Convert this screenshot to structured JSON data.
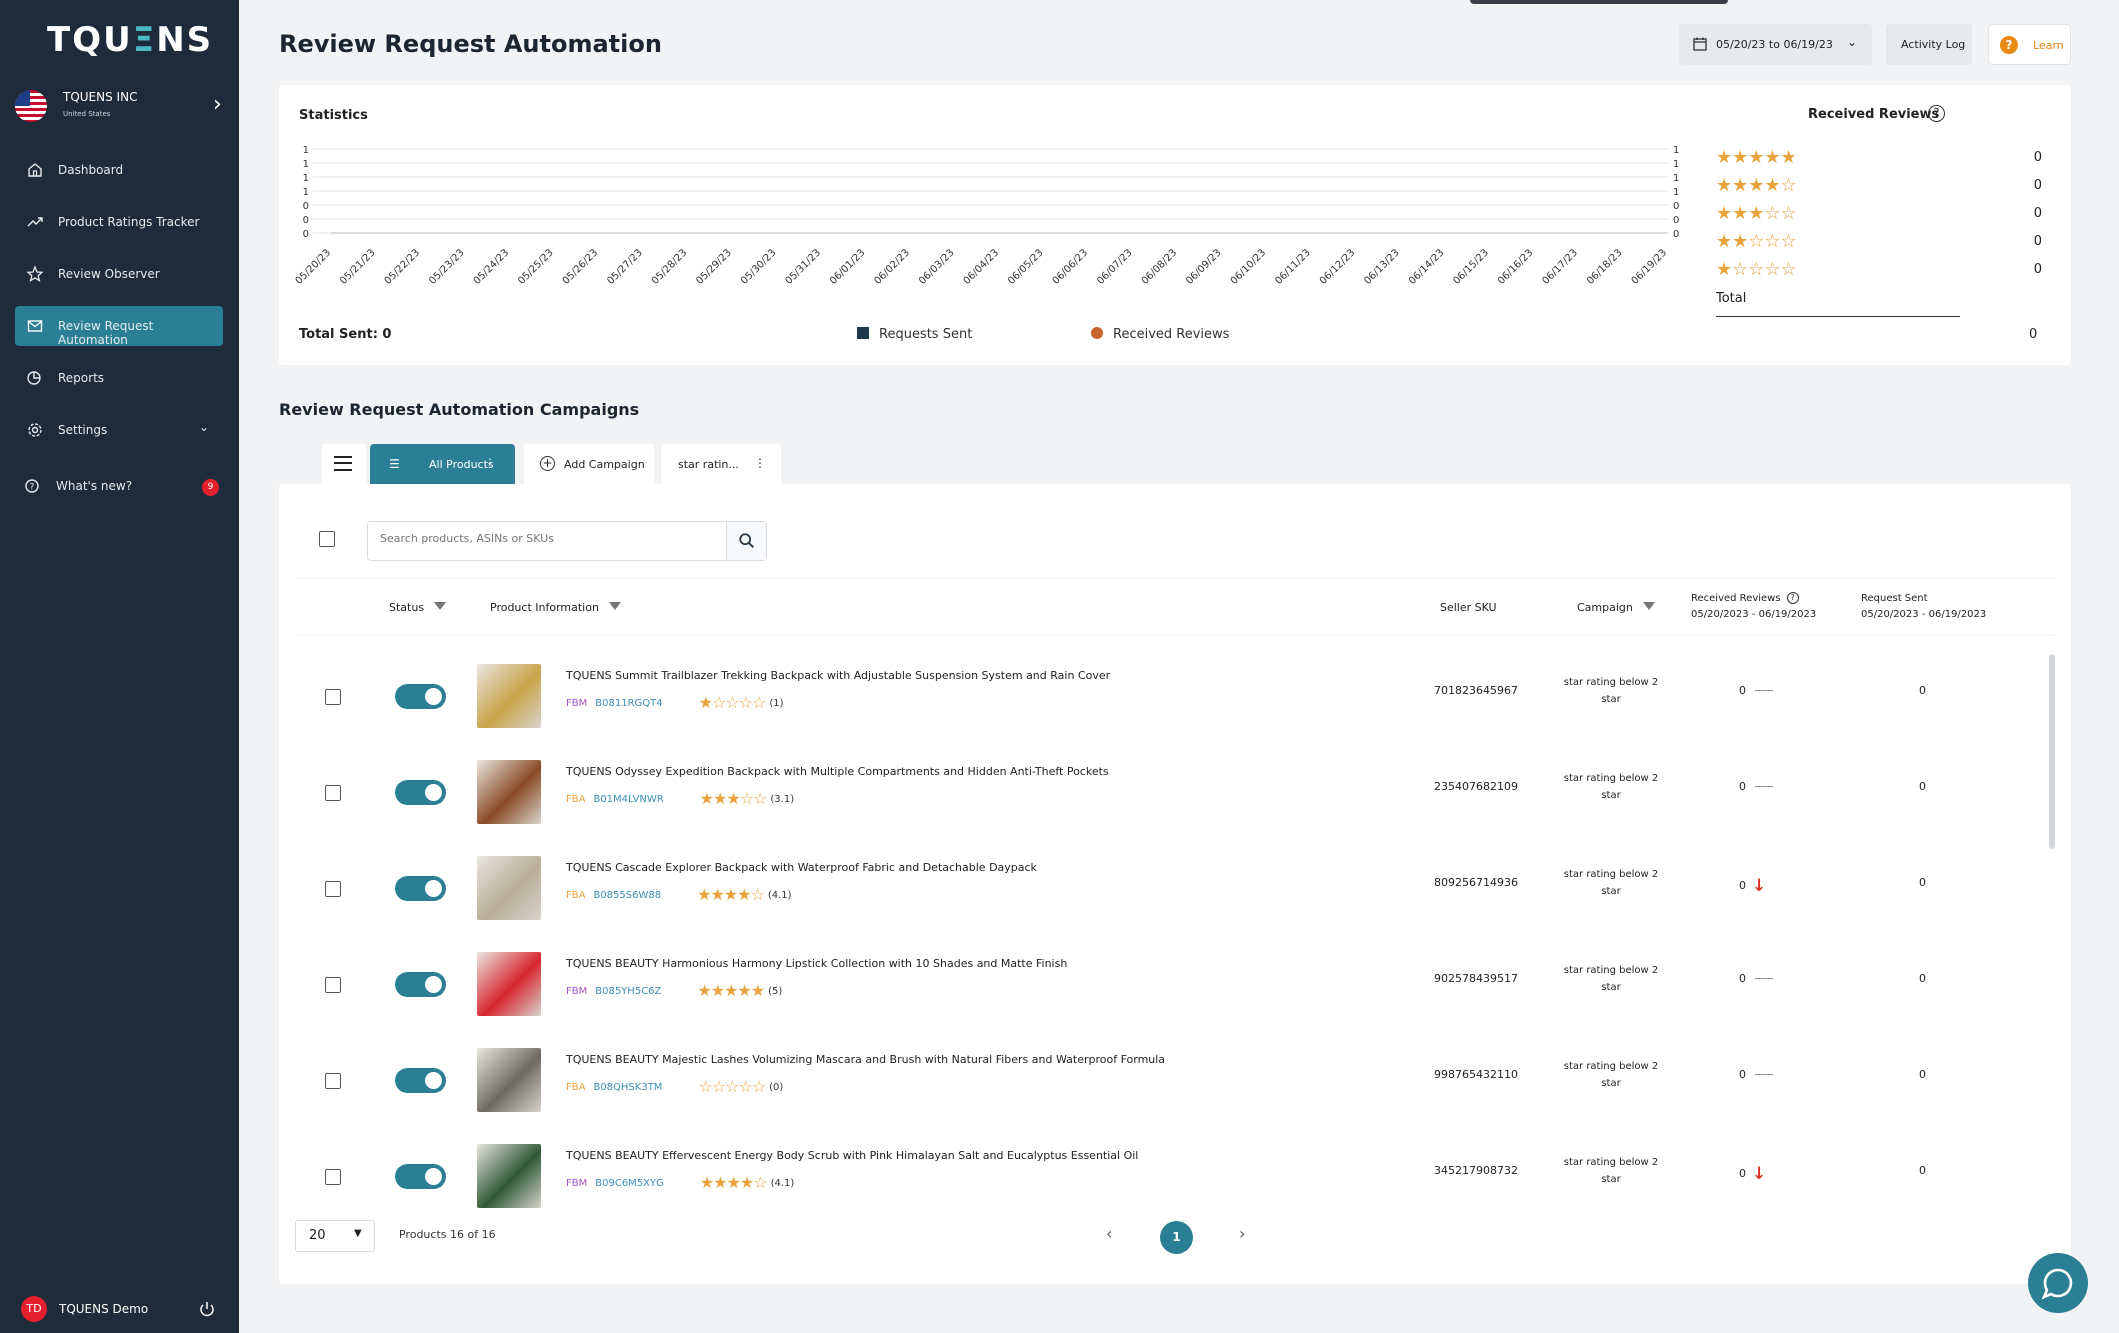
{
  "brand": {
    "logo_left": "TQU",
    "logo_accent": "Ξ",
    "logo_right": "NS"
  },
  "account": {
    "name": "TQUENS INC",
    "country": "United States"
  },
  "sidebar": {
    "items": [
      {
        "label": "Dashboard",
        "icon": "home-icon"
      },
      {
        "label": "Product Ratings Tracker",
        "icon": "trend-icon"
      },
      {
        "label": "Review Observer",
        "icon": "star-icon"
      },
      {
        "label": "Review Request Automation",
        "icon": "mail-icon",
        "active": true
      },
      {
        "label": "Reports",
        "icon": "report-icon"
      },
      {
        "label": "Settings",
        "icon": "gear-icon"
      },
      {
        "label": "What's new?",
        "icon": "help-icon",
        "badge": "9"
      }
    ]
  },
  "user": {
    "initials": "TD",
    "name": "TQUENS Demo"
  },
  "header": {
    "title": "Review Request Automation",
    "date_range": "05/20/23 to 06/19/23",
    "activity_log": "Activity Log",
    "learn": "Learn"
  },
  "stats": {
    "title": "Statistics",
    "total_sent": "Total Sent: 0",
    "legend": [
      {
        "name": "Requests Sent",
        "color": "#1e3a4c"
      },
      {
        "name": "Received Reviews",
        "color": "#c8652a"
      }
    ]
  },
  "chart_data": {
    "type": "line",
    "x": [
      "05/20/23",
      "05/21/23",
      "05/22/23",
      "05/23/23",
      "05/24/23",
      "05/25/23",
      "05/26/23",
      "05/27/23",
      "05/28/23",
      "05/29/23",
      "05/30/23",
      "05/31/23",
      "06/01/23",
      "06/02/23",
      "06/03/23",
      "06/04/23",
      "06/05/23",
      "06/06/23",
      "06/07/23",
      "06/08/23",
      "06/09/23",
      "06/10/23",
      "06/11/23",
      "06/12/23",
      "06/13/23",
      "06/14/23",
      "06/15/23",
      "06/16/23",
      "06/17/23",
      "06/18/23",
      "06/19/23"
    ],
    "y_ticks_left": [
      "1",
      "1",
      "1",
      "1",
      "0",
      "0",
      "0"
    ],
    "y_ticks_right": [
      "1",
      "1",
      "1",
      "1",
      "0",
      "0",
      "0"
    ],
    "series": [
      {
        "name": "Requests Sent",
        "values": [
          0,
          0,
          0,
          0,
          0,
          0,
          0,
          0,
          0,
          0,
          0,
          0,
          0,
          0,
          0,
          0,
          0,
          0,
          0,
          0,
          0,
          0,
          0,
          0,
          0,
          0,
          0,
          0,
          0,
          0,
          0
        ]
      },
      {
        "name": "Received Reviews",
        "values": [
          0,
          0,
          0,
          0,
          0,
          0,
          0,
          0,
          0,
          0,
          0,
          0,
          0,
          0,
          0,
          0,
          0,
          0,
          0,
          0,
          0,
          0,
          0,
          0,
          0,
          0,
          0,
          0,
          0,
          0,
          0
        ]
      }
    ],
    "grid": true
  },
  "received_reviews": {
    "title": "Received Reviews",
    "help": "?",
    "rows": [
      {
        "stars": "★★★★★",
        "count": "0"
      },
      {
        "stars": "★★★★☆",
        "count": "0"
      },
      {
        "stars": "★★★☆☆",
        "count": "0"
      },
      {
        "stars": "★★☆☆☆",
        "count": "0"
      },
      {
        "stars": "★☆☆☆☆",
        "count": "0"
      }
    ],
    "total_label": "Total",
    "total_value": "0"
  },
  "campaigns": {
    "title": "Review Request Automation Campaigns",
    "tabs": {
      "all": "All Products",
      "add": "Add Campaign",
      "star": "star ratin..."
    },
    "search_placeholder": "Search products, ASINs or SKUs",
    "columns": {
      "status": "Status",
      "product": "Product Information",
      "sku": "Seller SKU",
      "campaign": "Campaign",
      "received": "Received Reviews",
      "received_range": "05/20/2023 - 06/19/2023",
      "sent": "Request Sent",
      "sent_range": "05/20/2023 - 06/19/2023"
    },
    "rows": [
      {
        "name": "TQUENS Summit Trailblazer Trekking Backpack with Adjustable Suspension System and Rain Cover",
        "fulfillment": "FBM",
        "asin": "B0811RGQT4",
        "stars": "★☆☆☆☆",
        "rating": "(1)",
        "sku": "701823645967",
        "campaign": "star rating below 2 star",
        "received": "0",
        "trend": "flat",
        "sent": "0",
        "thumb_color": "#c9a44a"
      },
      {
        "name": "TQUENS Odyssey Expedition Backpack with Multiple Compartments and Hidden Anti-Theft Pockets",
        "fulfillment": "FBA",
        "asin": "B01M4LVNWR",
        "stars": "★★★☆☆",
        "rating": "(3.1)",
        "sku": "235407682109",
        "campaign": "star rating below 2 star",
        "received": "0",
        "trend": "flat",
        "sent": "0",
        "thumb_color": "#8a4b25"
      },
      {
        "name": "TQUENS Cascade Explorer Backpack with Waterproof Fabric and Detachable Daypack",
        "fulfillment": "FBA",
        "asin": "B0855S6W88",
        "stars": "★★★★☆",
        "rating": "(4.1)",
        "sku": "809256714936",
        "campaign": "star rating below 2 star",
        "received": "0",
        "trend": "down",
        "sent": "0",
        "thumb_color": "#b9ad96"
      },
      {
        "name": "TQUENS BEAUTY Harmonious Harmony Lipstick Collection with 10 Shades and Matte Finish",
        "fulfillment": "FBM",
        "asin": "B085YH5C6Z",
        "stars": "★★★★★",
        "rating": "(5)",
        "sku": "902578439517",
        "campaign": "star rating below 2 star",
        "received": "0",
        "trend": "flat",
        "sent": "0",
        "thumb_color": "#d7262e"
      },
      {
        "name": "TQUENS BEAUTY Majestic Lashes Volumizing Mascara and Brush with Natural Fibers and Waterproof Formula",
        "fulfillment": "FBA",
        "asin": "B08QHSK3TM",
        "stars": "☆☆☆☆☆",
        "rating": "(0)",
        "sku": "998765432110",
        "campaign": "star rating below 2 star",
        "received": "0",
        "trend": "flat",
        "sent": "0",
        "thumb_color": "#6f6a66"
      },
      {
        "name": "TQUENS BEAUTY Effervescent Energy Body Scrub with Pink Himalayan Salt and Eucalyptus Essential Oil",
        "fulfillment": "FBM",
        "asin": "B09C6M5XYG",
        "stars": "★★★★☆",
        "rating": "(4.1)",
        "sku": "345217908732",
        "campaign": "star rating below 2 star",
        "received": "0",
        "trend": "down",
        "sent": "0",
        "thumb_color": "#2f5a36"
      }
    ],
    "page_size": "20",
    "products_count": "Products 16 of 16",
    "current_page": "1"
  }
}
